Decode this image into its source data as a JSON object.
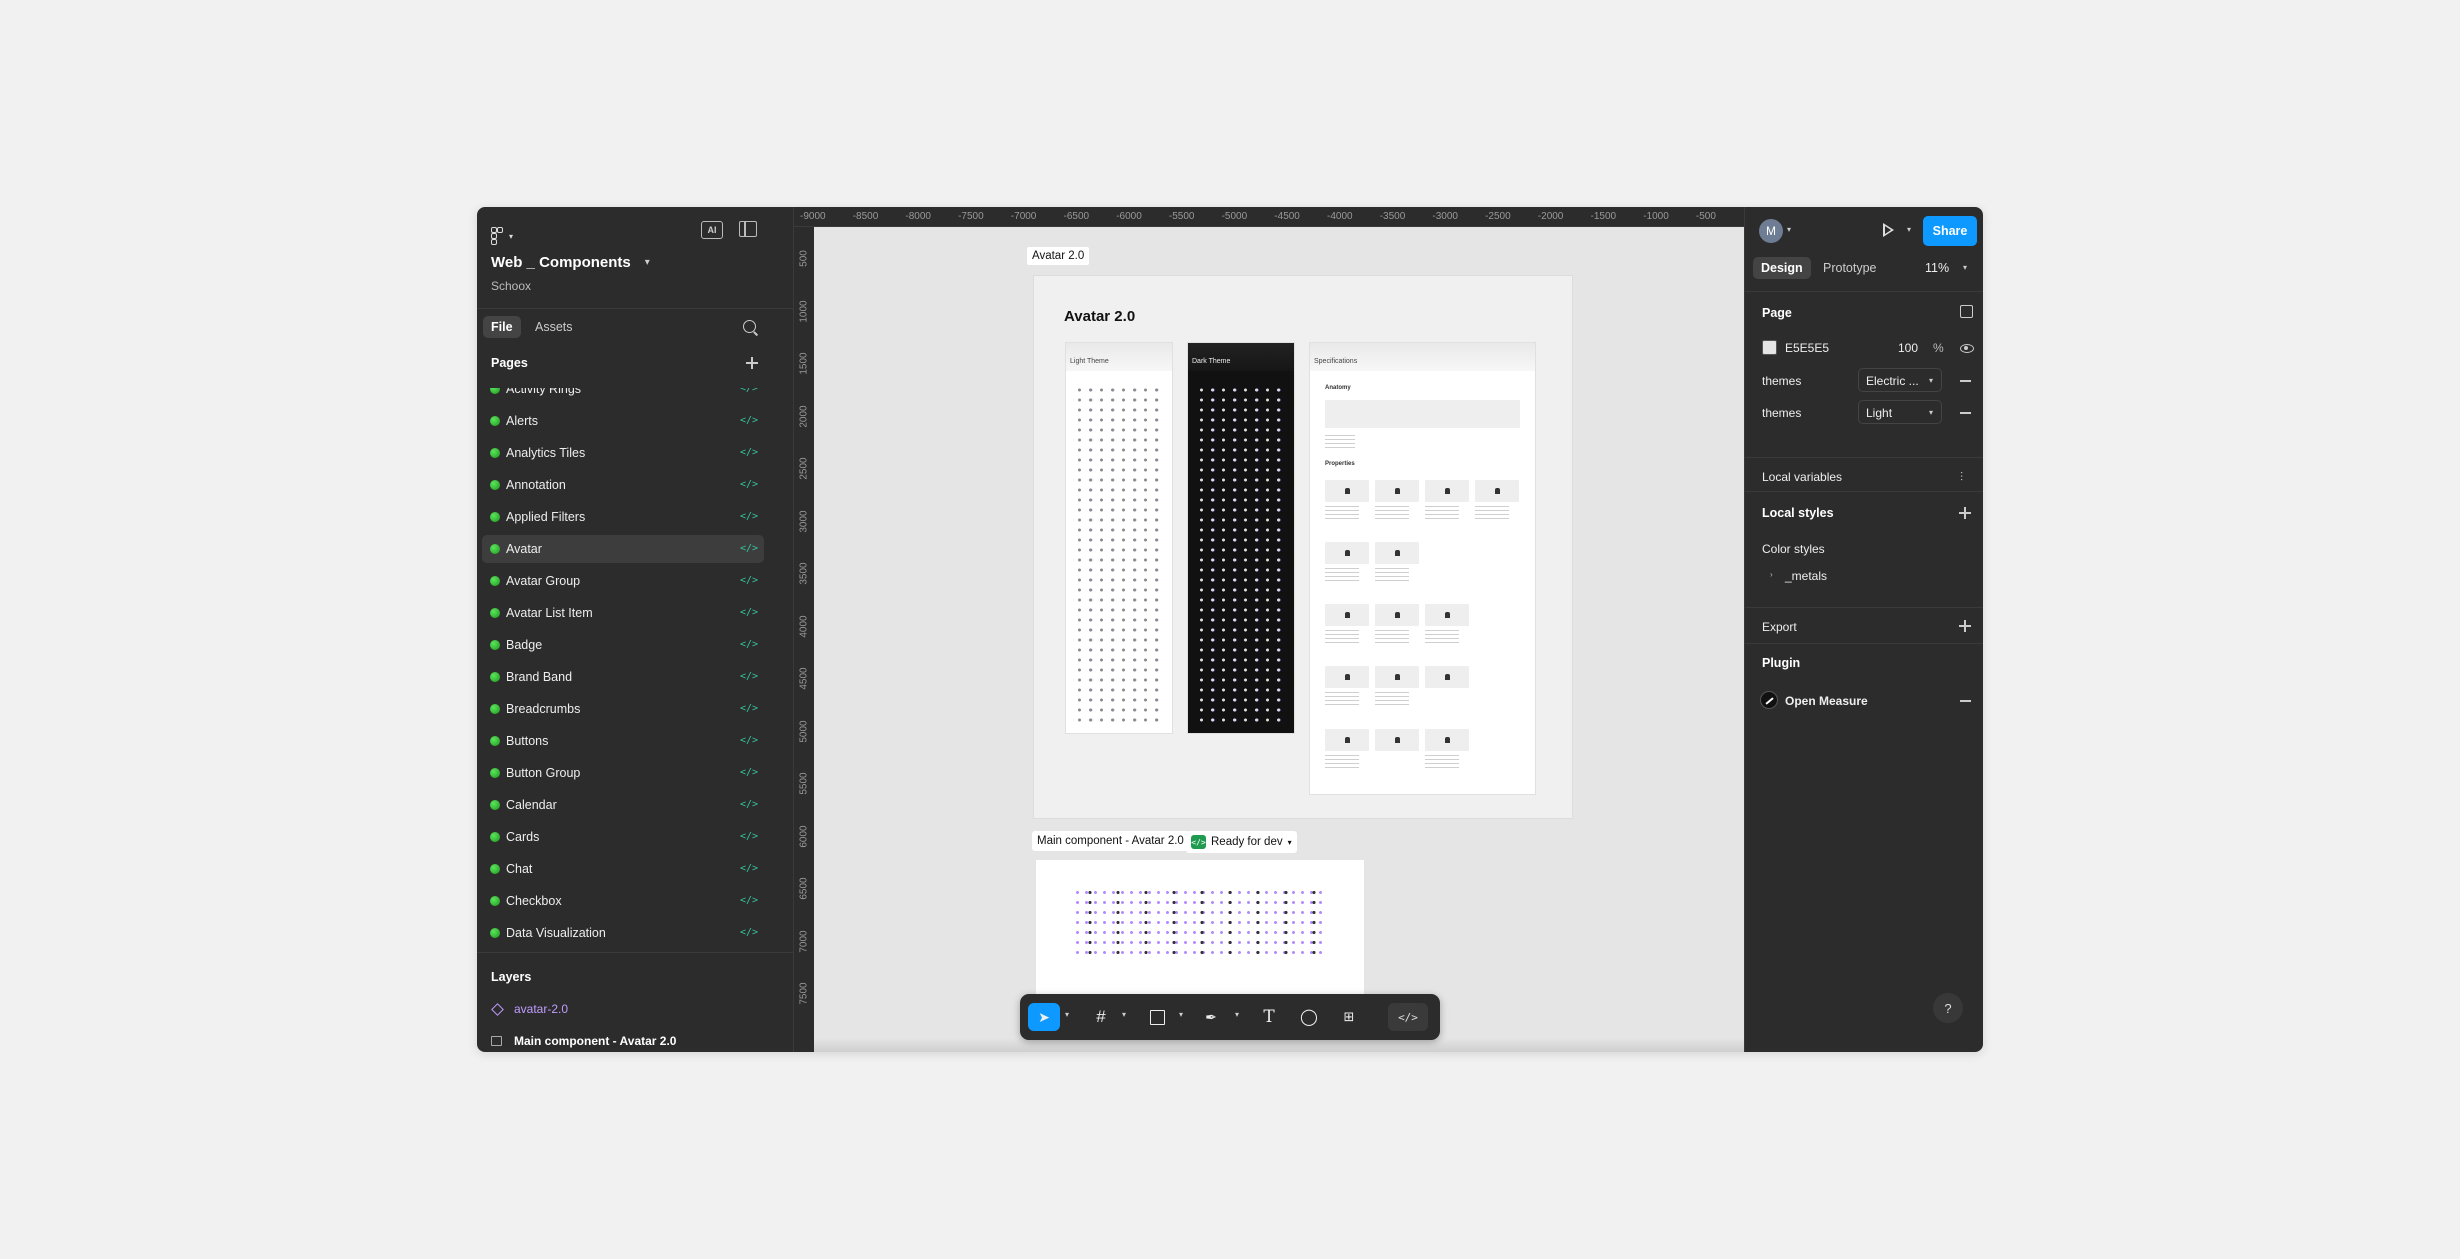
{
  "file": {
    "name": "Web _ Components",
    "team": "Schoox"
  },
  "left_tabs": {
    "file": "File",
    "assets": "Assets"
  },
  "tool_ai_label": "AI",
  "pages_title": "Pages",
  "pages": [
    "Activity Rings",
    "Alerts",
    "Analytics Tiles",
    "Annotation",
    "Applied Filters",
    "Avatar",
    "Avatar Group",
    "Avatar List Item",
    "Badge",
    "Brand Band",
    "Breadcrumbs",
    "Buttons",
    "Button Group",
    "Calendar",
    "Cards",
    "Chat",
    "Checkbox",
    "Data Visualization"
  ],
  "active_page": "Avatar",
  "page_status_color": "#22c322",
  "dev_mode_glyph": "</>",
  "layers_title": "Layers",
  "layers": [
    {
      "name": "avatar-2.0",
      "icon": "component-icon"
    },
    {
      "name": "Main component - Avatar 2.0",
      "icon": "frame-icon"
    }
  ],
  "ruler": {
    "top": [
      "-9000",
      "-8500",
      "-8000",
      "-7500",
      "-7000",
      "-6500",
      "-6000",
      "-5500",
      "-5000",
      "-4500",
      "-4000",
      "-3500",
      "-3000",
      "-2500",
      "-2000",
      "-1500",
      "-1000",
      "-500"
    ],
    "left": [
      "500",
      "1000",
      "1500",
      "2000",
      "2500",
      "3000",
      "3500",
      "4000",
      "4500",
      "5000",
      "5500",
      "6000",
      "6500",
      "7000",
      "7500"
    ]
  },
  "canvas": {
    "section_label": "Avatar 2.0",
    "section_heading": "Avatar 2.0",
    "frames": [
      "Light Theme",
      "Dark Theme",
      "Specifications"
    ],
    "spec": {
      "anatomy": "Anatomy",
      "properties": "Properties"
    },
    "main_component_label": "Main component - Avatar 2.0",
    "status_label": "Ready for dev"
  },
  "toolbar": {
    "items": [
      "move-tool",
      "frame-tool",
      "shape-tool",
      "pen-tool",
      "text-tool",
      "comment-tool",
      "actions-tool",
      "dev-mode-toggle"
    ]
  },
  "right": {
    "user_initial": "M",
    "share_label": "Share",
    "tabs": {
      "design": "Design",
      "prototype": "Prototype"
    },
    "zoom": "11%",
    "page_title": "Page",
    "bg_color_hex": "E5E5E5",
    "bg_opacity": "100",
    "percent_sign": "%",
    "variables": [
      {
        "label": "themes",
        "value": "Electric ..."
      },
      {
        "label": "themes",
        "value": "Light"
      }
    ],
    "local_variables": "Local variables",
    "local_styles": "Local styles",
    "color_styles": "Color styles",
    "style_group": "_metals",
    "export": "Export",
    "plugin": "Plugin",
    "plugin_name": "Open Measure",
    "help": "?"
  },
  "colors": {
    "accent": "#0d99ff",
    "panel": "#2c2c2c",
    "canvas_bg": "#e5e5e5",
    "ready_green": "#1f9a4f"
  }
}
